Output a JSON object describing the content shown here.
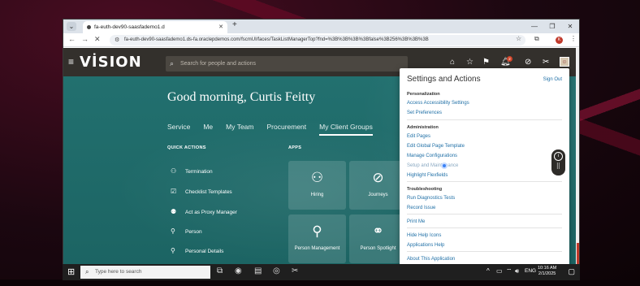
{
  "browser": {
    "tab_title": "fa-euth-dev90-saasfademo1.d",
    "new_tab": "+",
    "url": "fa-euth-dev90-saasfademo1.ds-fa.oraclepdemos.com/fscmUI/faces/TaskListManagerTop?fnd=%3B%3B%3B%3Bfalse%3B256%3B%3B%3B",
    "profile_initial": "K"
  },
  "app": {
    "logo": "VİSION",
    "search_placeholder": "Search for people and actions",
    "notification_count": "2",
    "greeting": "Good morning, Curtis Feitty",
    "tabs": [
      "Service",
      "Me",
      "My Team",
      "Procurement",
      "My Client Groups"
    ],
    "quick_actions_title": "QUICK ACTIONS",
    "apps_title": "APPS",
    "quick_actions": [
      "Termination",
      "Checklist Templates",
      "Act as Proxy Manager",
      "Person",
      "Personal Details"
    ],
    "apps": [
      {
        "label": "Hiring",
        "icon": "hiring-icon"
      },
      {
        "label": "Journeys",
        "icon": "journeys-icon"
      },
      {
        "label": "Person Management",
        "icon": "person-management-icon"
      },
      {
        "label": "Person Spotlight",
        "icon": "person-spotlight-icon"
      }
    ]
  },
  "panel": {
    "title": "Settings and Actions",
    "sign_out": "Sign Out",
    "personalization": {
      "title": "Personalization",
      "items": [
        "Access Accessibility Settings",
        "Set Preferences"
      ]
    },
    "administration": {
      "title": "Administration",
      "items": [
        "Edit Pages",
        "Edit Global Page Template",
        "Manage Configurations",
        "Setup and Maintenance",
        "Highlight Flexfields"
      ]
    },
    "troubleshooting": {
      "title": "Troubleshooting",
      "items": [
        "Run Diagnostics Tests",
        "Record Issue"
      ]
    },
    "misc": [
      "Print Me",
      "Hide Help Icons",
      "Applications Help",
      "About This Application"
    ]
  },
  "taskbar": {
    "search_placeholder": "Type here to search",
    "language": "ENG",
    "time": "10:16 AM",
    "date": "2/1/2025"
  },
  "colors": {
    "oracle_header": "#33302c",
    "teal": "#1f6b6a",
    "link": "#1f6fa6"
  }
}
